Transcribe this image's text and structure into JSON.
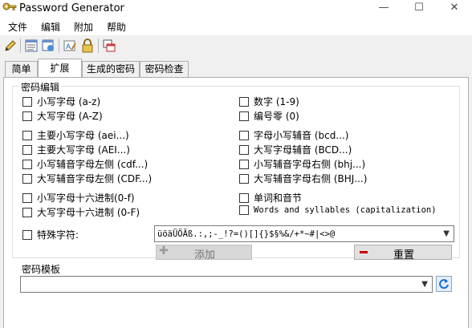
{
  "window": {
    "title": "Password Generator",
    "minimize": "—",
    "maximize": "☐",
    "close": "✕"
  },
  "menu": [
    "文件",
    "编辑",
    "附加",
    "帮助"
  ],
  "tabs": [
    "简单",
    "扩展",
    "生成的密码",
    "密码检查"
  ],
  "group_title": "密码编辑",
  "left_checkboxes": [
    "小写字母 (a-z)",
    "大写字母 (A-Z)",
    "主要小写字母 (aei...)",
    "主要大写字母 (AEI...)",
    "小写辅音字母左侧 (cdf...)",
    "大写辅音字母左侧  (CDF...)",
    "小写字母十六进制(0-f)",
    "大写字母十六进制 (0-F)"
  ],
  "right_checkboxes": [
    "数字 (1-9)",
    "编号零 (0)",
    "字母小写辅音 (bcd...)",
    "大写字母辅音 (BCD...)",
    "小写辅音字母右侧 (bhj...)",
    "大写辅音字母右侧  (BHJ...)",
    "单词和音节",
    "Words and syllables (capitalization)"
  ],
  "special": {
    "label": "特殊字符:",
    "value": "üöäÜÖÄß.:,;-_!?=()[]{}$§%&/+*~#|<>@",
    "add_label": "添加",
    "reset_label": "重置"
  },
  "template": {
    "label": "密码模板",
    "value": ""
  },
  "colors": {
    "reset_icon": "#cc0000",
    "add_icon": "#9a9a9a"
  }
}
